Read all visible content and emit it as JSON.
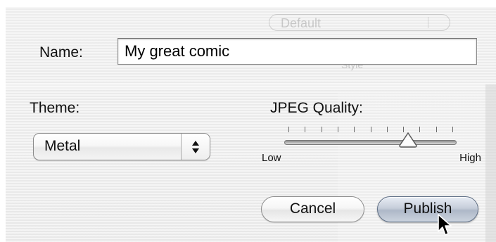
{
  "background": {
    "ghost_popup_text": "Default",
    "ghost_style_text": "Style"
  },
  "name": {
    "label": "Name:",
    "value": "My great comic"
  },
  "theme": {
    "label": "Theme:",
    "selected": "Metal"
  },
  "jpeg_quality": {
    "label": "JPEG Quality:",
    "min_label": "Low",
    "max_label": "High",
    "value_fraction": 0.73,
    "tick_count": 11
  },
  "buttons": {
    "cancel_label": "Cancel",
    "publish_label": "Publish"
  },
  "colors": {
    "default_button_accent": "#aeb8c8",
    "panel_background": "#ececec"
  },
  "icons": {
    "popup_stepper": "up-down-arrows-icon",
    "slider_knob": "triangle-knob-icon",
    "cursor": "arrow-cursor-icon"
  }
}
